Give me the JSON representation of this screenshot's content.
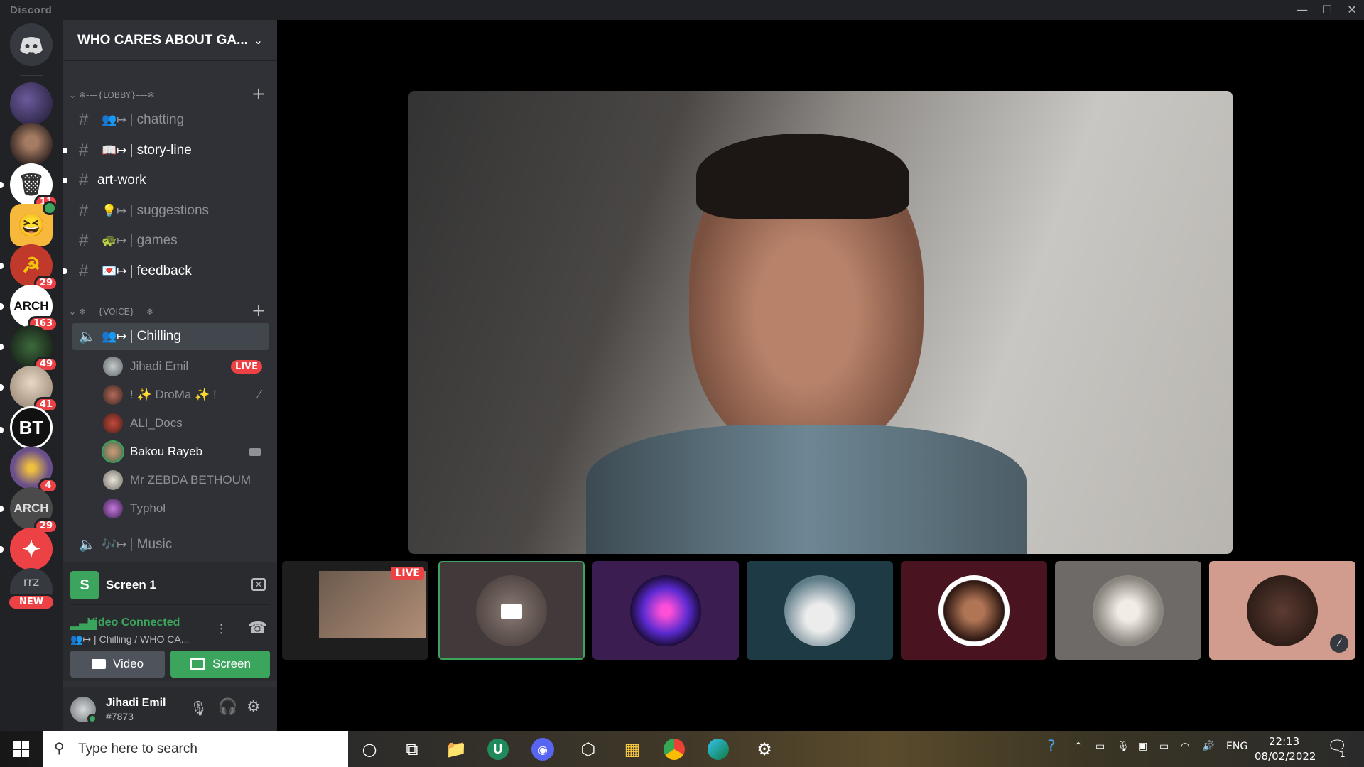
{
  "window": {
    "title": "Discord",
    "controls": [
      "—",
      "☐",
      "✕"
    ]
  },
  "server_rail": {
    "servers": [
      {
        "name": "discord-home",
        "bg": "#36393f",
        "badge": null
      },
      {
        "name": "server-dark",
        "bg": "#3d3a55",
        "badge": null
      },
      {
        "name": "server-avatar-man",
        "bg": "#5b4a42",
        "badge": null
      },
      {
        "name": "server-trash",
        "bg": "#ffffff",
        "badge": "11"
      },
      {
        "name": "server-emoji",
        "bg": "#f6b93b",
        "badge": null
      },
      {
        "name": "server-hammer-sickle",
        "bg": "#c0392b",
        "badge": "29"
      },
      {
        "name": "server-arch",
        "bg": "#ffffff",
        "badge": "163",
        "text": "ARCH"
      },
      {
        "name": "server-ggg",
        "bg": "#2f2f2f",
        "badge": "49"
      },
      {
        "name": "server-anime",
        "bg": "#d7c6b5",
        "badge": "41"
      },
      {
        "name": "server-bt",
        "bg": "#111111",
        "badge": null,
        "text": "BT"
      },
      {
        "name": "server-colorful",
        "bg": "#6a4f8b",
        "badge": "4"
      },
      {
        "name": "server-arch-2",
        "bg": "#4a4a4a",
        "badge": "29",
        "text": "ARCH"
      },
      {
        "name": "server-red-star",
        "bg": "#ed4245",
        "badge": null
      },
      {
        "name": "server-rrz",
        "bg": "#36393f",
        "badge": "NEW",
        "text": "rrz"
      }
    ]
  },
  "sidebar": {
    "server_name": "WHO CARES ABOUT GA...",
    "categories": [
      {
        "label": "❄-—{LOBBY}-—❄"
      },
      {
        "label": "❄-—{VOICE}-—❄"
      }
    ],
    "text_channels": [
      {
        "emoji": "👥↦",
        "label": "| chatting",
        "bold": false
      },
      {
        "emoji": "📖↦",
        "label": "| story-line",
        "bold": true
      },
      {
        "emoji": "",
        "label": "art-work",
        "bold": true
      },
      {
        "emoji": "💡↦",
        "label": "| suggestions",
        "bold": false
      },
      {
        "emoji": "🐢↦",
        "label": "| games",
        "bold": false
      },
      {
        "emoji": "💌↦",
        "label": "| feedback",
        "bold": true
      }
    ],
    "voice_channels": [
      {
        "emoji": "👥↦",
        "label": "| Chilling"
      },
      {
        "emoji": "🎶↦",
        "label": "| Music"
      }
    ],
    "voice_members": [
      {
        "name": "Jihadi Emil",
        "status": "LIVE"
      },
      {
        "name": "! ✨ DroMa ✨ !",
        "status": "muted"
      },
      {
        "name": "ALI_Docs",
        "status": ""
      },
      {
        "name": "Bakou Rayeb",
        "status": "video"
      },
      {
        "name": "Mr ZEBDA BETHOUM",
        "status": ""
      },
      {
        "name": "Typhol",
        "status": ""
      }
    ]
  },
  "voice_panel": {
    "screen_label": "Screen 1",
    "screen_icon_letter": "S",
    "connection_status": "Video Connected",
    "connection_detail": "👥↦ | Chilling / WHO CA...",
    "video_button": "Video",
    "screen_button": "Screen"
  },
  "user_panel": {
    "username": "Jihadi Emil",
    "discriminator": "#7873"
  },
  "stage": {
    "live_badge": "LIVE",
    "tiles": [
      {
        "name": "screen-share-tile",
        "bg": "#1e1e1e"
      },
      {
        "name": "camera-off-tile",
        "bg": "#42393a"
      },
      {
        "name": "neon-mask-tile",
        "bg": "#3b1d52"
      },
      {
        "name": "old-man-tile",
        "bg": "#1e3a45"
      },
      {
        "name": "bearded-man-tile",
        "bg": "#4a1320"
      },
      {
        "name": "garlic-tile",
        "bg": "#6e6a67"
      },
      {
        "name": "dark-photo-tile",
        "bg": "#d19b8d"
      }
    ]
  },
  "taskbar": {
    "search_placeholder": "Type here to search",
    "language": "ENG",
    "time": "22:13",
    "date": "08/02/2022",
    "notification_count": "1"
  }
}
